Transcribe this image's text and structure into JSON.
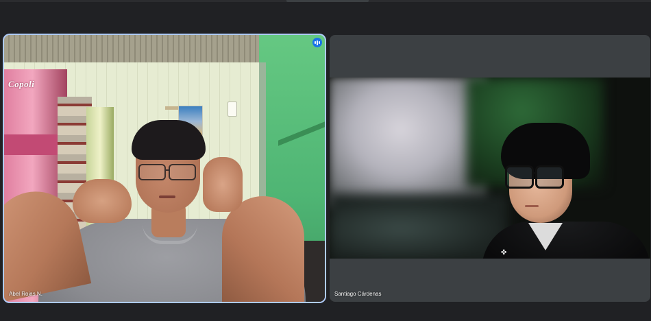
{
  "meeting": {
    "accent_color": "#aecbfa",
    "background_color": "#202124",
    "tile_color": "#3c4043"
  },
  "participants": [
    {
      "name": "Abel Rojas N.",
      "speaking": true,
      "speaking_icon": "audio-wave-icon"
    },
    {
      "name": "Santiago Cárdenas",
      "speaking": false
    }
  ],
  "decor": {
    "brand_text": "Copoli"
  }
}
